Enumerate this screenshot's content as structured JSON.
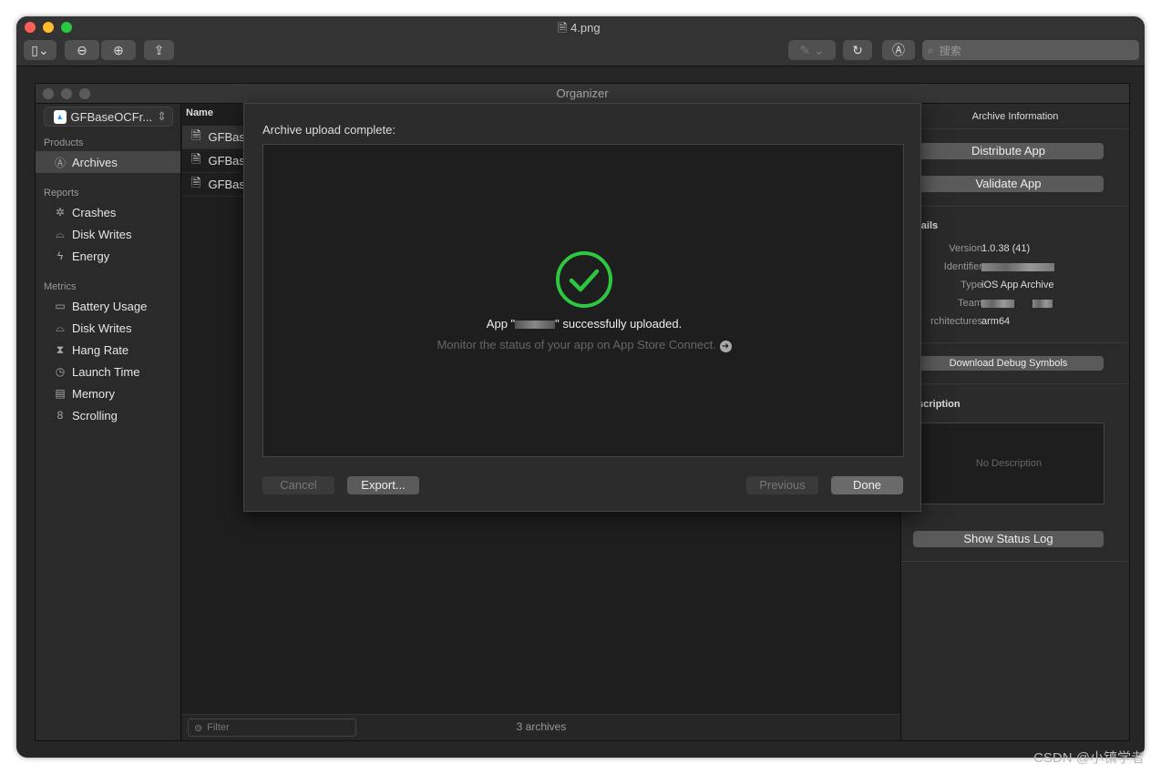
{
  "preview": {
    "title": "4.png",
    "search_placeholder": "搜索"
  },
  "organizer": {
    "title": "Organizer",
    "scheme": "GFBaseOCFr...",
    "sidebar": {
      "sections": [
        {
          "label": "Products",
          "items": [
            {
              "label": "Archives",
              "icon": "archive-icon",
              "selected": true
            }
          ]
        },
        {
          "label": "Reports",
          "items": [
            {
              "label": "Crashes",
              "icon": "crash-icon"
            },
            {
              "label": "Disk Writes",
              "icon": "disk-icon"
            },
            {
              "label": "Energy",
              "icon": "energy-icon"
            }
          ]
        },
        {
          "label": "Metrics",
          "items": [
            {
              "label": "Battery Usage",
              "icon": "battery-icon"
            },
            {
              "label": "Disk Writes",
              "icon": "disk-icon"
            },
            {
              "label": "Hang Rate",
              "icon": "hourglass-icon"
            },
            {
              "label": "Launch Time",
              "icon": "clock-icon"
            },
            {
              "label": "Memory",
              "icon": "memory-icon"
            },
            {
              "label": "Scrolling",
              "icon": "scroll-icon"
            }
          ]
        }
      ]
    },
    "list": {
      "column": "Name",
      "rows": [
        "GFBas",
        "GFBas",
        "GFBas"
      ],
      "filter_placeholder": "Filter",
      "count": "3 archives"
    },
    "info": {
      "header": "Archive Information",
      "distribute": "Distribute App",
      "validate": "Validate App",
      "details_title": "etails",
      "version_label": "Version",
      "version": "1.0.38 (41)",
      "identifier_label": "Identifier",
      "type_label": "Type",
      "type": "iOS App Archive",
      "team_label": "Team",
      "arch_label": "rchitectures",
      "arch": "arm64",
      "debug_symbols": "Download Debug Symbols",
      "description_title": "escription",
      "no_description": "No Description",
      "status_log": "Show Status Log"
    }
  },
  "sheet": {
    "title": "Archive upload complete:",
    "message_prefix": "App \"",
    "message_suffix": "\" successfully uploaded.",
    "monitor": "Monitor the status of your app on App Store Connect.",
    "cancel": "Cancel",
    "export": "Export...",
    "previous": "Previous",
    "done": "Done",
    "success_color": "#2ec840"
  },
  "watermark": "CSDN @小镇学者"
}
